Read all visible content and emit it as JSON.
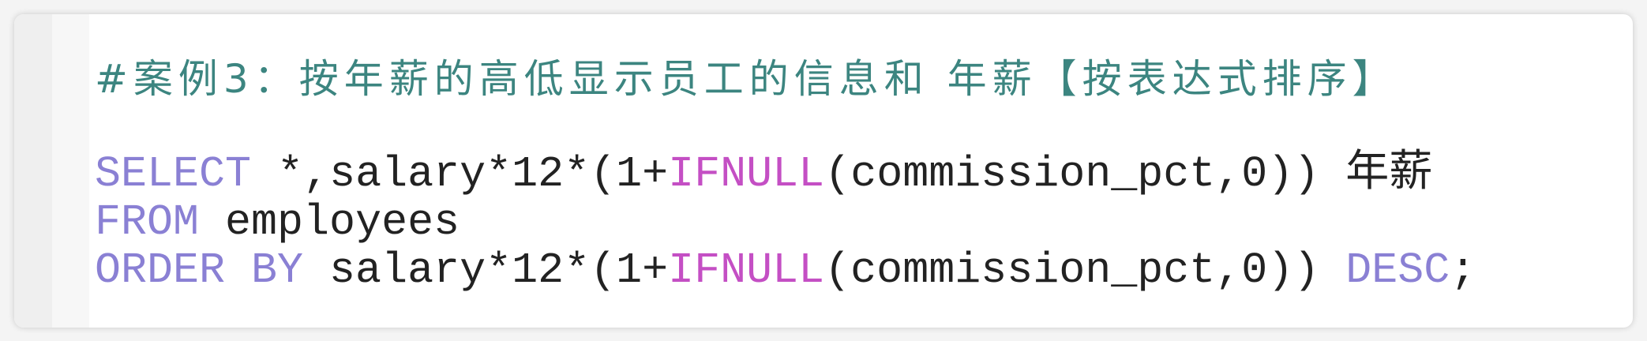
{
  "comment": "#案例3：按年薪的高低显示员工的信息和 年薪【按表达式排序】",
  "lines": [
    {
      "kw1": "SELECT",
      "t1": " *,salary*12*(1+",
      "fn": "IFNULL",
      "t2": "(commission_pct,0)) 年薪"
    },
    {
      "kw1": "FROM",
      "t1": " employees"
    },
    {
      "kw1": "ORDER BY",
      "t1": " salary*12*(1+",
      "fn": "IFNULL",
      "t2": "(commission_pct,0)) ",
      "kw2": "DESC",
      "t3": ";"
    }
  ],
  "colors": {
    "comment": "#3c8580",
    "keyword": "#8a80d4",
    "function": "#c44fc4",
    "text": "#222222"
  }
}
